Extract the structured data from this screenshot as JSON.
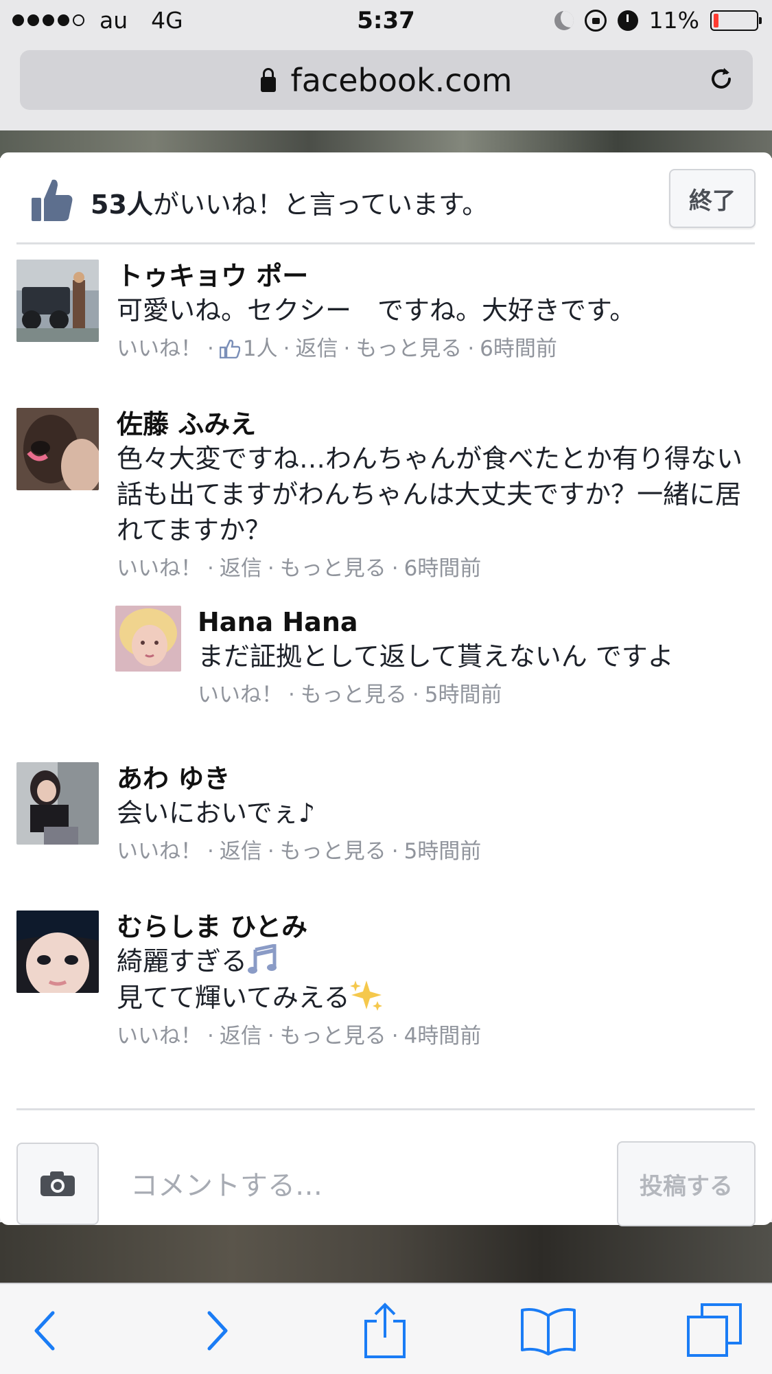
{
  "status_bar": {
    "carrier": "au",
    "network": "4G",
    "time": "5:37",
    "battery": "11%",
    "battery_level": 0.11,
    "battery_color": "#ff3b30"
  },
  "browser": {
    "url": "facebook.com"
  },
  "likes": {
    "count": "53人",
    "suffix": "がいいね！と言っています。",
    "close_label": "終了"
  },
  "comments": [
    {
      "name": "トゥキョウ ポー",
      "text": "可愛いね。セクシー　ですね。大好きです。",
      "like_label": "いいね！",
      "like_count": "1人",
      "reply_label": "返信",
      "more_label": "もっと見る",
      "time": "6時間前"
    },
    {
      "name": "佐藤 ふみえ",
      "text": "色々大変ですね…わんちゃんが食べたとか有り得ない話も出てますがわんちゃんは大丈夫ですか？一緒に居れてますか？",
      "like_label": "いいね！",
      "reply_label": "返信",
      "more_label": "もっと見る",
      "time": "6時間前",
      "reply": {
        "name": "Hana Hana",
        "text": "まだ証拠として返して貰えないん ですよ",
        "like_label": "いいね！",
        "more_label": "もっと見る",
        "time": "5時間前"
      }
    },
    {
      "name": "あわ ゆき",
      "text": "会いにおいでぇ♪",
      "like_label": "いいね！",
      "reply_label": "返信",
      "more_label": "もっと見る",
      "time": "5時間前"
    },
    {
      "name": "むらしま ひとみ",
      "text_line1": "綺麗すぎる",
      "text_line2": "見てて輝いてみえる",
      "like_label": "いいね！",
      "reply_label": "返信",
      "more_label": "もっと見る",
      "time": "4時間前"
    }
  ],
  "compose": {
    "placeholder": "コメントする…",
    "post_label": "投稿する"
  },
  "toolbar": {
    "icons": [
      "back-icon",
      "forward-icon",
      "share-icon",
      "bookmarks-icon",
      "tabs-icon"
    ],
    "accent_color": "#1a7cf5"
  },
  "colors": {
    "meta_text": "#90949c",
    "facebook_blue": "#4267b2"
  }
}
